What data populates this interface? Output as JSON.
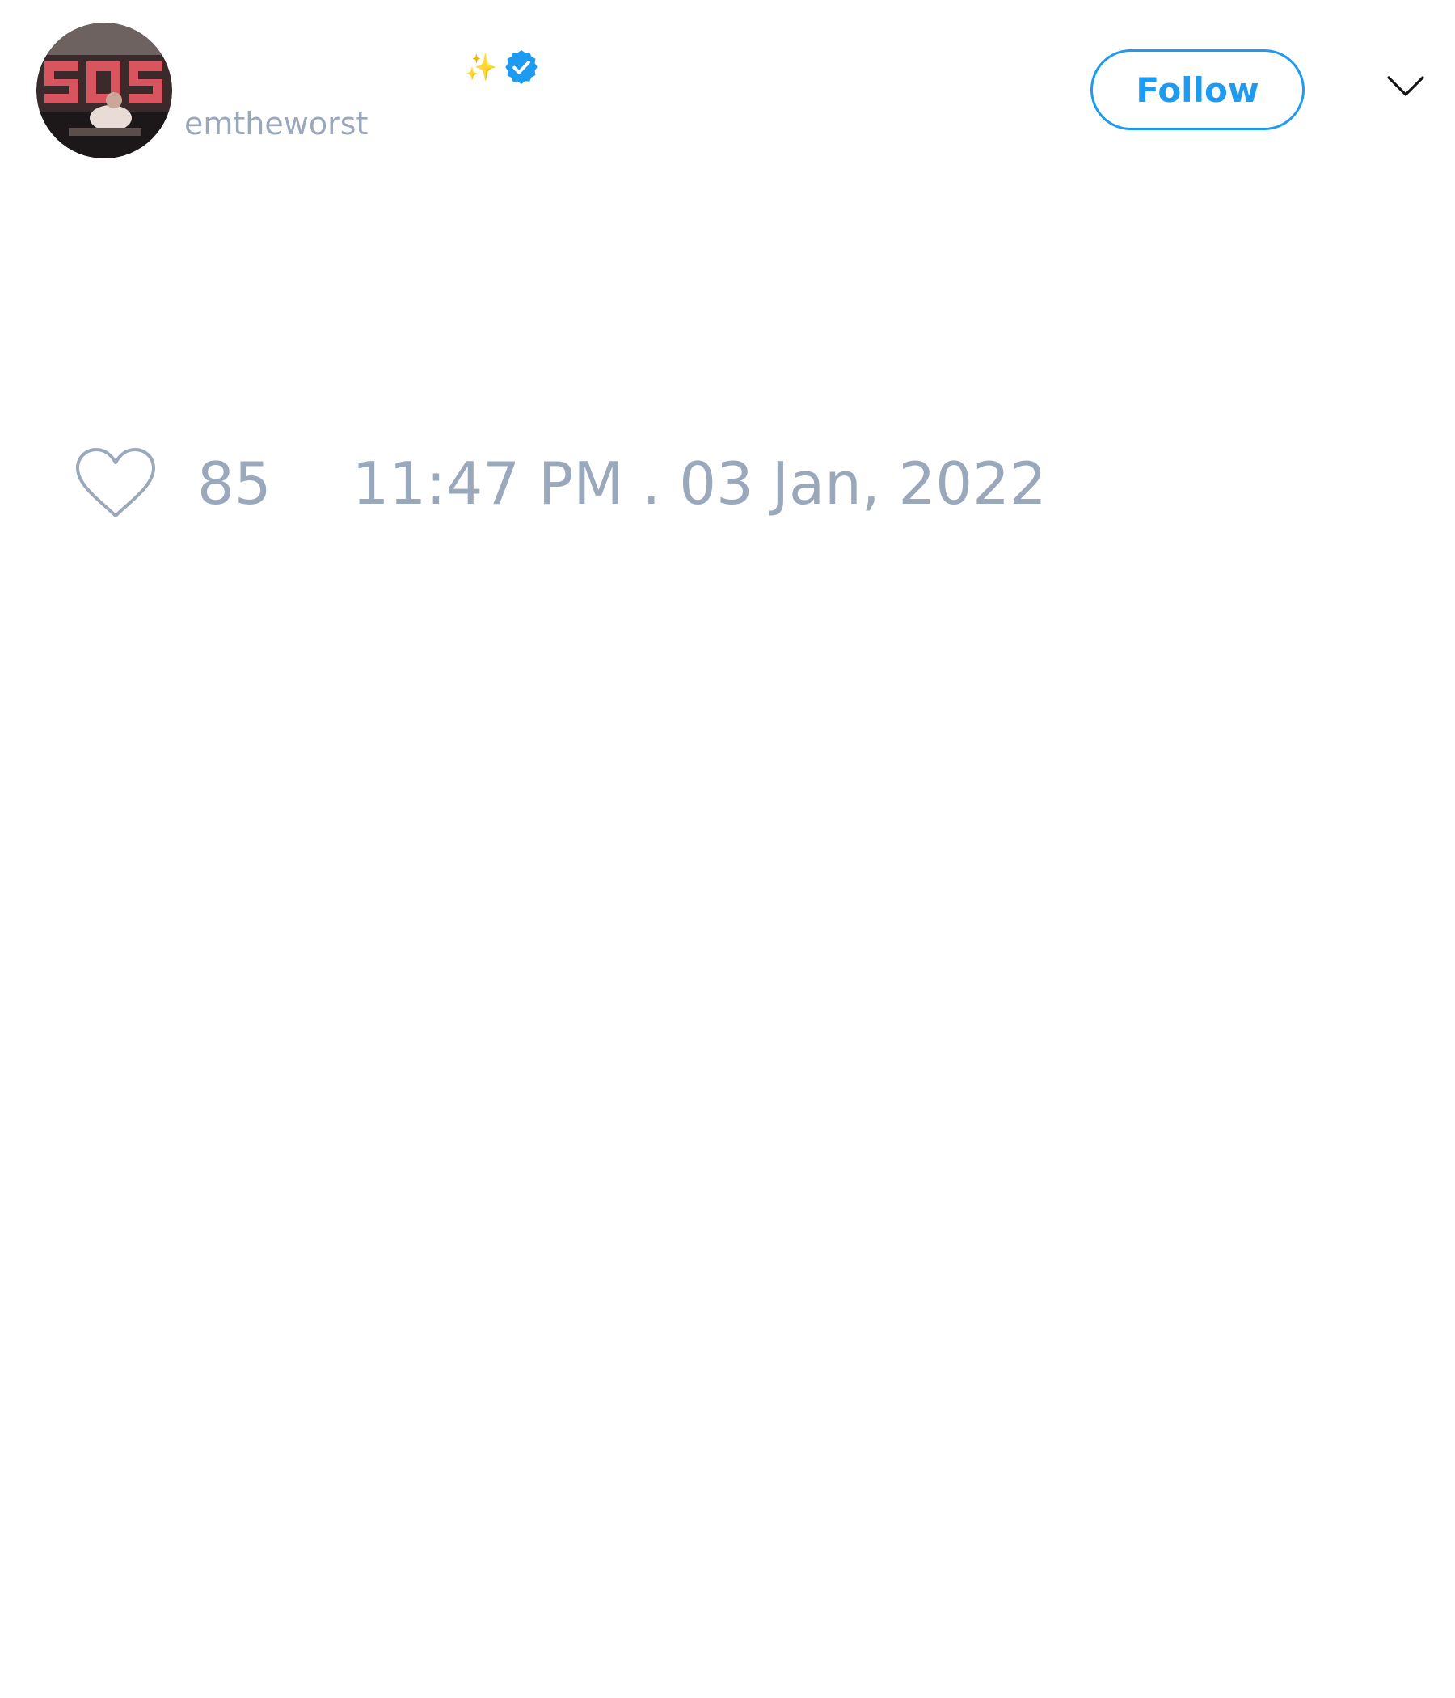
{
  "author": {
    "display_name_emoji": "✨",
    "handle": "emtheworst",
    "verified": true,
    "avatar_icon": "profile-photo"
  },
  "actions": {
    "follow_label": "Follow",
    "menu_icon": "chevron-down-icon"
  },
  "engagement": {
    "like_icon": "heart-icon",
    "like_count": "85",
    "timestamp": "11:47 PM . 03 Jan, 2022"
  },
  "colors": {
    "accent": "#1d9bf0",
    "muted_text": "#9aa8bb",
    "background": "#ffffff"
  }
}
